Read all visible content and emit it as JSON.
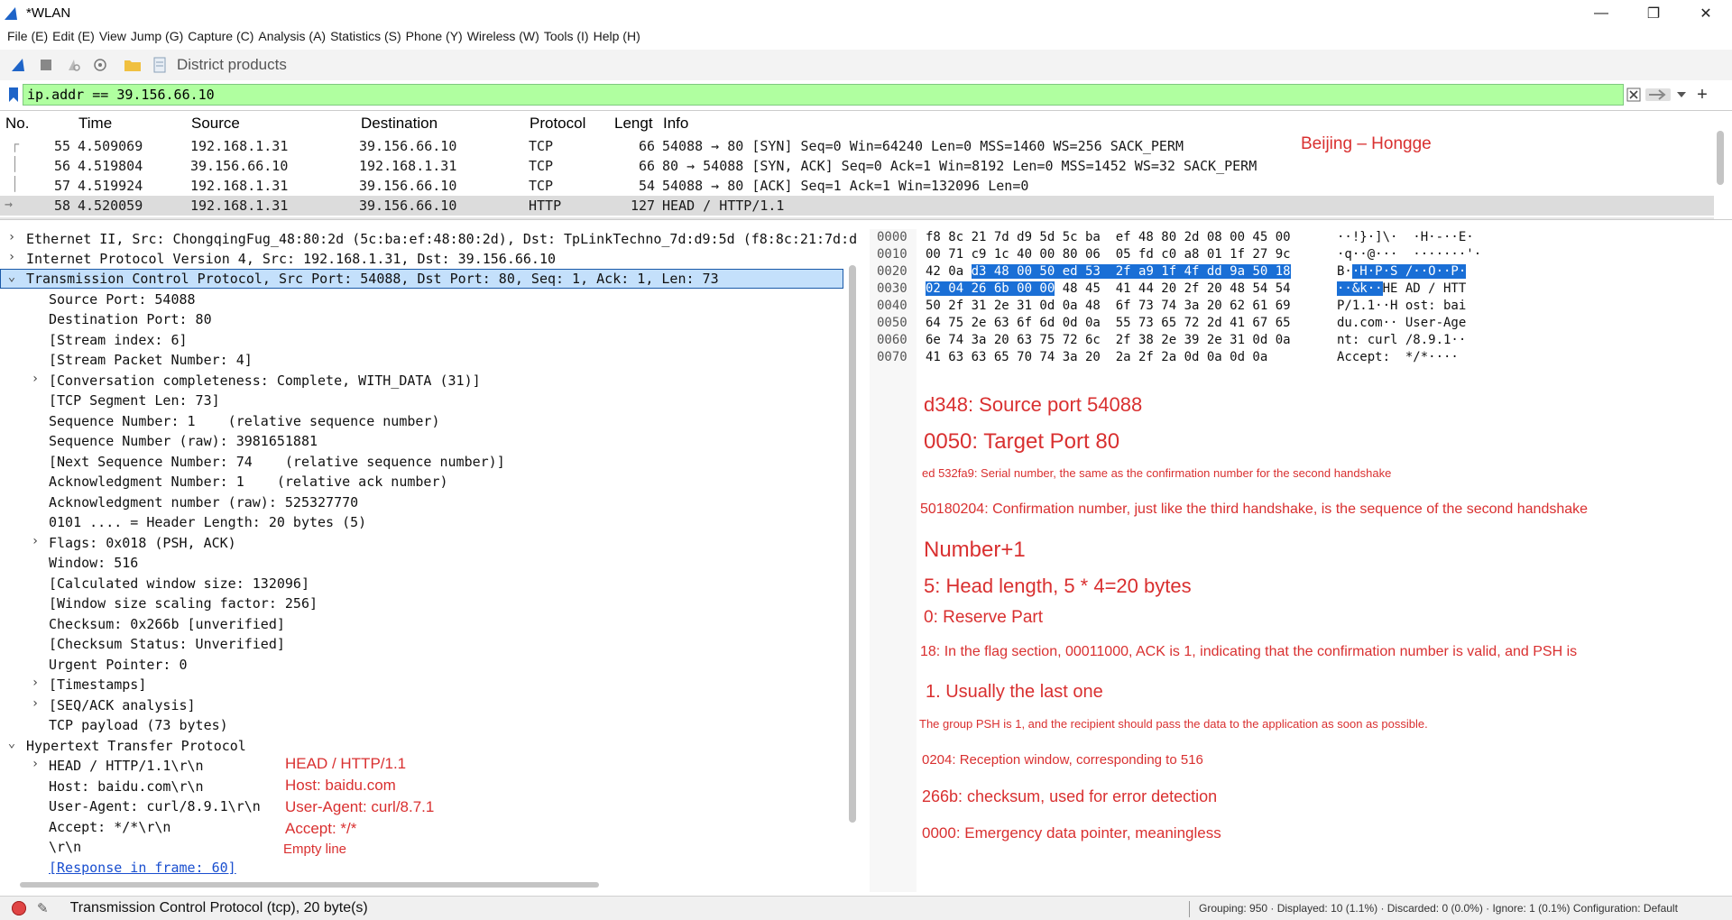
{
  "window": {
    "title": "*WLAN"
  },
  "menu": [
    "File (E)",
    "Edit (E)",
    "View",
    "Jump (G)",
    "Capture (C)",
    "Analysis (A)",
    "Statistics (S)",
    "Phone (Y)",
    "Wireless (W)",
    "Tools (I)",
    "Help (H)"
  ],
  "toolbar": {
    "label": "District products"
  },
  "filter": {
    "value": "ip.addr == 39.156.66.10"
  },
  "packet_list": {
    "columns": [
      "No.",
      "Time",
      "Source",
      "Destination",
      "Protocol",
      "Lengt",
      "Info"
    ],
    "rows": [
      {
        "no": "55",
        "time": "4.509069",
        "src": "192.168.1.31",
        "dst": "39.156.66.10",
        "proto": "TCP",
        "len": "66",
        "info": "54088 → 80 [SYN] Seq=0 Win=64240 Len=0 MSS=1460 WS=256 SACK_PERM"
      },
      {
        "no": "56",
        "time": "4.519804",
        "src": "39.156.66.10",
        "dst": "192.168.1.31",
        "proto": "TCP",
        "len": "66",
        "info": "80 → 54088 [SYN, ACK] Seq=0 Ack=1 Win=8192 Len=0 MSS=1452 WS=32 SACK_PERM"
      },
      {
        "no": "57",
        "time": "4.519924",
        "src": "192.168.1.31",
        "dst": "39.156.66.10",
        "proto": "TCP",
        "len": "54",
        "info": "54088 → 80 [ACK] Seq=1 Ack=1 Win=132096 Len=0"
      },
      {
        "no": "58",
        "time": "4.520059",
        "src": "192.168.1.31",
        "dst": "39.156.66.10",
        "proto": "HTTP",
        "len": "127",
        "info": "HEAD / HTTP/1.1"
      }
    ],
    "annotation": "Beijing – Hongge"
  },
  "details": {
    "eth": "Ethernet II, Src: ChongqingFug_48:80:2d (5c:ba:ef:48:80:2d), Dst: TpLinkTechno_7d:d9:5d (f8:8c:21:7d:d",
    "ip": "Internet Protocol Version 4, Src: 192.168.1.31, Dst: 39.156.66.10",
    "tcp": "Transmission Control Protocol, Src Port: 54088, Dst Port: 80, Seq: 1, Ack: 1, Len: 73",
    "tcp_fields": [
      "Source Port: 54088",
      "Destination Port: 80",
      "[Stream index: 6]",
      "[Stream Packet Number: 4]",
      "[Conversation completeness: Complete, WITH_DATA (31)]",
      "[TCP Segment Len: 73]",
      "Sequence Number: 1    (relative sequence number)",
      "Sequence Number (raw): 3981651881",
      "[Next Sequence Number: 74    (relative sequence number)]",
      "Acknowledgment Number: 1    (relative ack number)",
      "Acknowledgment number (raw): 525327770",
      "0101 .... = Header Length: 20 bytes (5)",
      "Flags: 0x018 (PSH, ACK)",
      "Window: 516",
      "[Calculated window size: 132096]",
      "[Window size scaling factor: 256]",
      "Checksum: 0x266b [unverified]",
      "[Checksum Status: Unverified]",
      "Urgent Pointer: 0",
      "[Timestamps]",
      "[SEQ/ACK analysis]",
      "TCP payload (73 bytes)"
    ],
    "http": "Hypertext Transfer Protocol",
    "http_fields": [
      "HEAD / HTTP/1.1\\r\\n",
      "Host: baidu.com\\r\\n",
      "User-Agent: curl/8.9.1\\r\\n",
      "Accept: */*\\r\\n",
      "\\r\\n",
      "[Response in frame: 60]"
    ],
    "http_annotations": [
      "HEAD / HTTP/1.1",
      "Host: baidu.com",
      "User-Agent: curl/8.7.1",
      "Accept: */*",
      "Empty line"
    ]
  },
  "bytes": {
    "rows": [
      {
        "off": "0000",
        "hex": "f8 8c 21 7d d9 5d 5c ba  ef 48 80 2d 08 00 45 00",
        "asc": "··!}·]\\·  ·H·-··E·"
      },
      {
        "off": "0010",
        "hex": "00 71 c9 1c 40 00 80 06  05 fd c0 a8 01 1f 27 9c",
        "asc": "·q··@···  ·······'·"
      },
      {
        "off": "0020",
        "hex_pre": "42 0a ",
        "hex_hl": "d3 48 00 50 ed 53  2f a9 1f 4f dd 9a 50 18",
        "asc_pre": "B·",
        "asc_hl": "·H·P·S /··O··P·"
      },
      {
        "off": "0030",
        "hex_hl": "02 04 26 6b 00 00",
        "hex_post": " 48 45  41 44 20 2f 20 48 54 54",
        "asc_hl": "··&k··",
        "asc_post": "HE AD / HTT"
      },
      {
        "off": "0040",
        "hex": "50 2f 31 2e 31 0d 0a 48  6f 73 74 3a 20 62 61 69",
        "asc": "P/1.1··H ost: bai"
      },
      {
        "off": "0050",
        "hex": "64 75 2e 63 6f 6d 0d 0a  55 73 65 72 2d 41 67 65",
        "asc": "du.com·· User-Age"
      },
      {
        "off": "0060",
        "hex": "6e 74 3a 20 63 75 72 6c  2f 38 2e 39 2e 31 0d 0a",
        "asc": "nt: curl /8.9.1··"
      },
      {
        "off": "0070",
        "hex": "41 63 63 65 70 74 3a 20  2a 2f 2a 0d 0a 0d 0a",
        "asc": "Accept:  */*····"
      }
    ],
    "annotations": [
      "d348: Source port 54088",
      "0050: Target Port 80",
      "ed 532fa9: Serial number, the same as the confirmation number for the second handshake",
      "50180204: Confirmation number, just like the third handshake, is the sequence of the second handshake",
      "Number+1",
      "5: Head length, 5 * 4=20 bytes",
      "0: Reserve Part",
      "18: In the flag section, 00011000, ACK is 1, indicating that the confirmation number is valid, and PSH is",
      "1. Usually the last one",
      "The group PSH is 1, and the recipient should pass the data to the application as soon as possible.",
      "0204: Reception window, corresponding to 516",
      "266b: checksum, used for error detection",
      "0000: Emergency data pointer, meaningless"
    ]
  },
  "status": {
    "text": "Transmission Control Protocol (tcp), 20 byte(s)",
    "right": "Grouping: 950 · Displayed: 10 (1.1%) · Discarded: 0 (0.0%) · Ignore: 1 (0.1%) Configuration: Default"
  },
  "colors": {
    "filter_bg": "#b0ffa0",
    "selection": "#1a6fd6",
    "annotation": "#d93030"
  },
  "icons": [
    "shark-fin-icon",
    "stop-icon",
    "restart-icon",
    "options-icon",
    "folder-icon",
    "file-icon",
    "bookmark-icon",
    "clear-icon",
    "apply-arrow-icon",
    "dropdown-icon",
    "plus-icon",
    "record-icon",
    "edit-icon"
  ]
}
